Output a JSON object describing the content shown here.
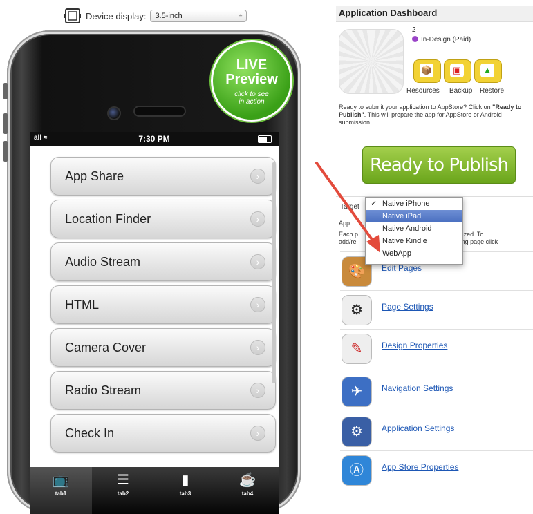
{
  "device_bar": {
    "label": "Device display:",
    "selected": "3.5-inch",
    "arrow": "÷"
  },
  "phone": {
    "status_time": "7:30 PM",
    "signal": "all ≈",
    "live_badge": {
      "line1": "LIVE",
      "line2": "Preview",
      "line3": "click to see",
      "line4": "in action"
    },
    "menu_items": [
      {
        "label": "App Share"
      },
      {
        "label": "Location Finder"
      },
      {
        "label": "Audio Stream"
      },
      {
        "label": "HTML"
      },
      {
        "label": "Camera Cover"
      },
      {
        "label": "Radio Stream"
      },
      {
        "label": "Check In"
      }
    ],
    "tabs": [
      {
        "label": "tab1",
        "icon": "tv-icon"
      },
      {
        "label": "tab2",
        "icon": "list-icon"
      },
      {
        "label": "tab3",
        "icon": "book-icon"
      },
      {
        "label": "tab4",
        "icon": "coffee-icon"
      }
    ]
  },
  "panel": {
    "title": "Application Dashboard",
    "app_number": "2",
    "app_status": "In-Design (Paid)",
    "actions": [
      {
        "label": "Resources",
        "icon": "box-icon"
      },
      {
        "label": "Backup",
        "icon": "backup-icon"
      },
      {
        "label": "Restore",
        "icon": "restore-icon"
      }
    ],
    "ready_text_1": "Ready to submit your application to AppStore? Click on",
    "ready_text_bold": "\"Ready to Publish\"",
    "ready_text_2": ". This will prepare the app for AppStore or Android submission.",
    "publish_button": "Ready to Publish",
    "target_label": "Target",
    "app_label": "App",
    "each_text_1": "Each p",
    "each_text_2": "stomized. To",
    "each_text_3": "add/re",
    "each_text_4": "isting page click",
    "dropdown": [
      {
        "label": "Native iPhone",
        "checked": true
      },
      {
        "label": "Native iPad",
        "highlighted": true
      },
      {
        "label": "Native Android"
      },
      {
        "label": "Native Kindle"
      },
      {
        "label": "WebApp"
      }
    ],
    "links": [
      {
        "label": "Edit Pages",
        "icon": "palette-icon"
      },
      {
        "label": "Page Settings",
        "icon": "gear-icon"
      },
      {
        "label": "Design Properties",
        "icon": "css-icon"
      },
      {
        "label": "Navigation Settings",
        "icon": "compass-icon"
      },
      {
        "label": "Application Settings",
        "icon": "gears-icon"
      },
      {
        "label": "App Store Properties",
        "icon": "appstore-icon"
      }
    ]
  },
  "colors": {
    "publish_green": "#7cb52b",
    "live_green": "#4fba21",
    "link_blue": "#1d57b5",
    "status_purple": "#9a43c8",
    "arrow_red": "#e34b3c"
  }
}
